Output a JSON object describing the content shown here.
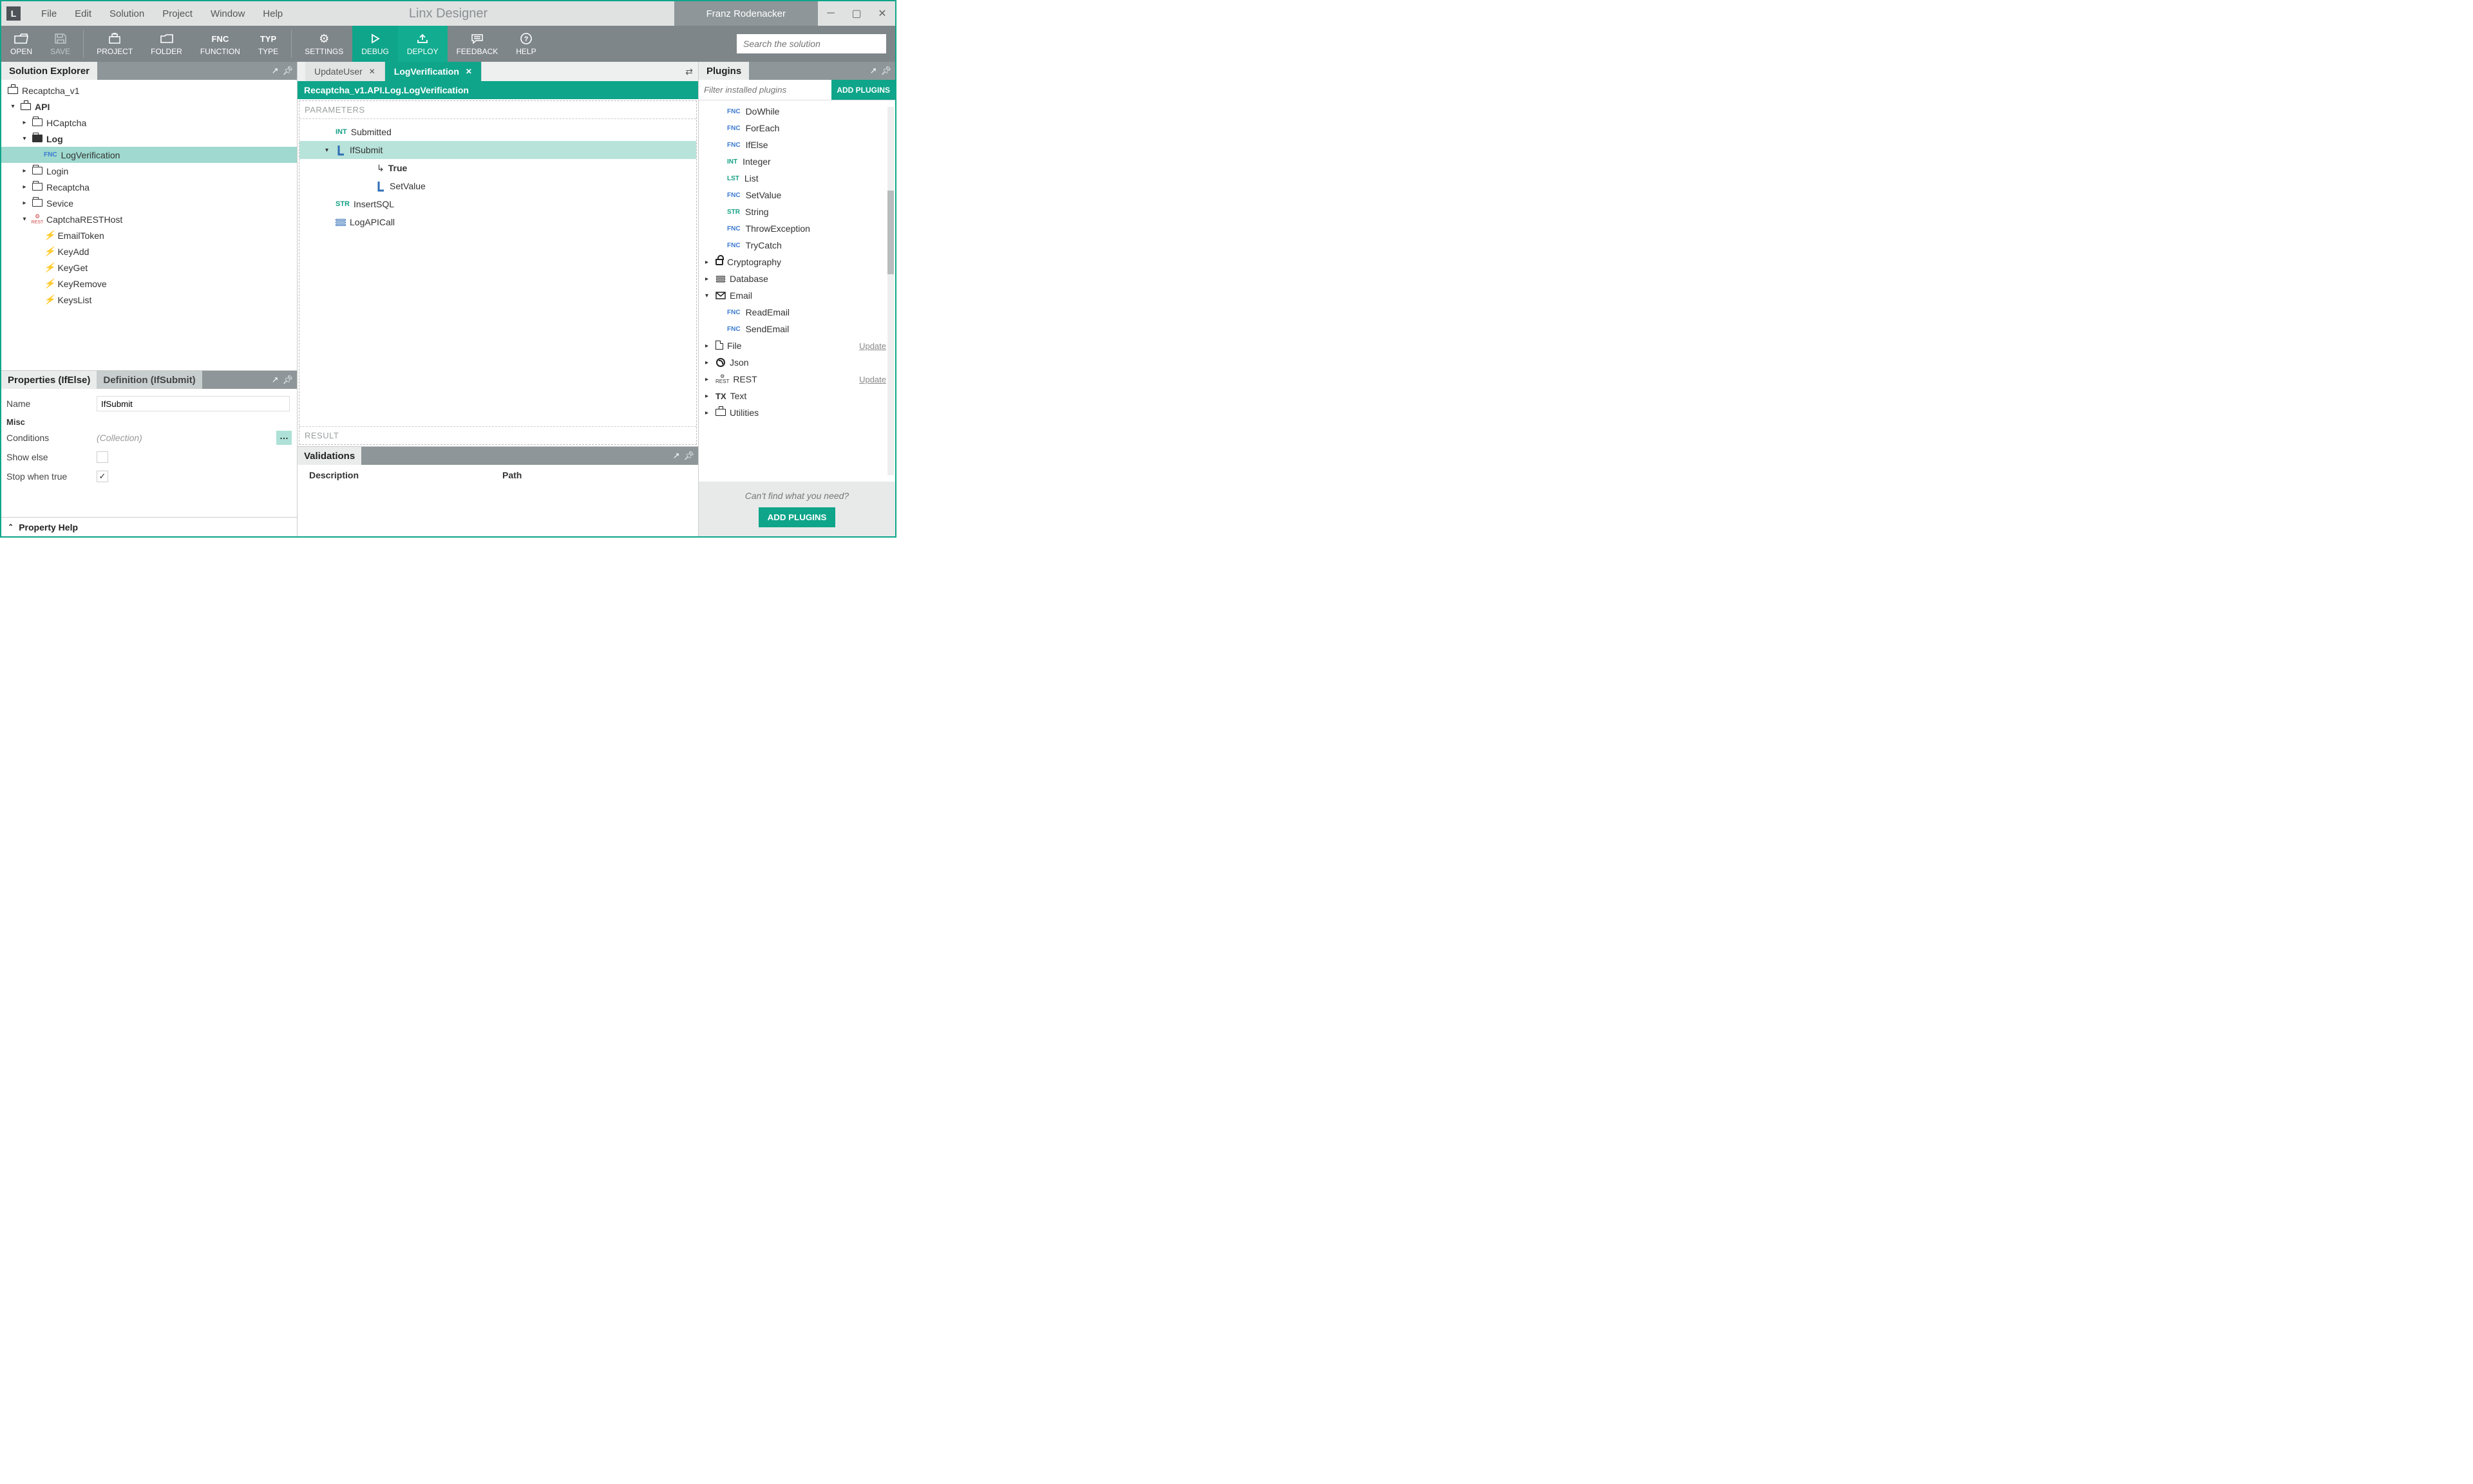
{
  "app": {
    "title": "Linx Designer",
    "user": "Franz Rodenacker",
    "logo": "L"
  },
  "menu": [
    "File",
    "Edit",
    "Solution",
    "Project",
    "Window",
    "Help"
  ],
  "toolbar": {
    "open": "OPEN",
    "save": "SAVE",
    "project": "PROJECT",
    "folder": "FOLDER",
    "function": "FUNCTION",
    "function_top": "FNC",
    "type": "TYPE",
    "type_top": "TYP",
    "settings": "SETTINGS",
    "debug": "DEBUG",
    "deploy": "DEPLOY",
    "feedback": "FEEDBACK",
    "help": "HELP",
    "search_placeholder": "Search the solution"
  },
  "solution_explorer": {
    "title": "Solution Explorer",
    "root": "Recaptcha_v1",
    "api": "API",
    "items": {
      "hcaptcha": "HCaptcha",
      "log": "Log",
      "logverification": "LogVerification",
      "login": "Login",
      "recaptcha": "Recaptcha",
      "sevice": "Sevice",
      "resthost": "CaptchaRESTHost",
      "events": [
        "EmailToken",
        "KeyAdd",
        "KeyGet",
        "KeyRemove",
        "KeysList"
      ]
    }
  },
  "properties": {
    "tab1": "Properties (IfElse)",
    "tab2": "Definition (IfSubmit)",
    "name_label": "Name",
    "name_value": "IfSubmit",
    "misc": "Misc",
    "conditions_label": "Conditions",
    "conditions_value": "(Collection)",
    "showelse_label": "Show else",
    "stopwhentrue_label": "Stop when true",
    "help": "Property Help"
  },
  "editor": {
    "tabs": [
      {
        "label": "UpdateUser",
        "active": false
      },
      {
        "label": "LogVerification",
        "active": true
      }
    ],
    "breadcrumb": "Recaptcha_v1.API.Log.LogVerification",
    "parameters": "PARAMETERS",
    "result": "RESULT",
    "flow": {
      "submitted": "Submitted",
      "ifsubmit": "IfSubmit",
      "true": "True",
      "setvalue": "SetValue",
      "insertsql": "InsertSQL",
      "logapicall": "LogAPICall"
    }
  },
  "validations": {
    "title": "Validations",
    "col1": "Description",
    "col2": "Path"
  },
  "plugins": {
    "title": "Plugins",
    "filter_placeholder": "Filter installed plugins",
    "add_button": "ADD PLUGINS",
    "fns": [
      {
        "badge": "FNC",
        "label": "DoWhile"
      },
      {
        "badge": "FNC",
        "label": "ForEach"
      },
      {
        "badge": "FNC",
        "label": "IfElse"
      },
      {
        "badge": "INT",
        "label": "Integer"
      },
      {
        "badge": "LST",
        "label": "List"
      },
      {
        "badge": "FNC",
        "label": "SetValue"
      },
      {
        "badge": "STR",
        "label": "String"
      },
      {
        "badge": "FNC",
        "label": "ThrowException"
      },
      {
        "badge": "FNC",
        "label": "TryCatch"
      }
    ],
    "cats": {
      "cryptography": "Cryptography",
      "database": "Database",
      "email": "Email",
      "readmail": "ReadEmail",
      "sendmail": "SendEmail",
      "file": "File",
      "json": "Json",
      "rest": "REST",
      "text": "Text",
      "utilities": "Utilities"
    },
    "update": "Update",
    "footer_text": "Can't find what you need?",
    "footer_button": "ADD PLUGINS"
  }
}
